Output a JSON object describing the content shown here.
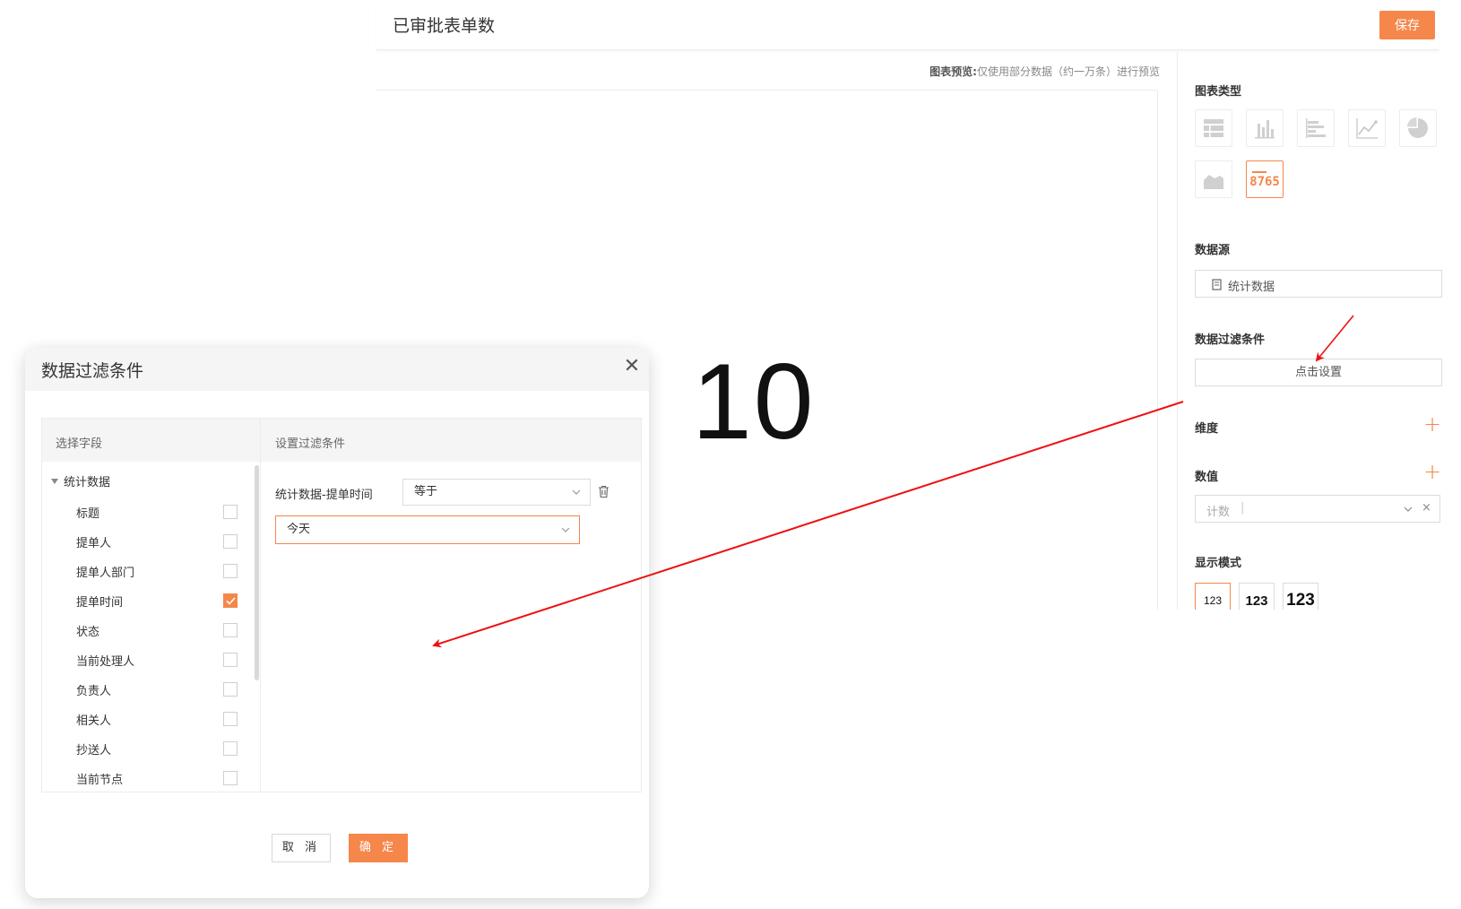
{
  "header": {
    "title": "已审批表单数",
    "save_label": "保存"
  },
  "preview": {
    "note_label": "图表预览:",
    "note_text": "仅使用部分数据（约一万条）进行预览",
    "value": "10"
  },
  "right_panel": {
    "chart_type_title": "图表类型",
    "chart_types": [
      "table-chart-icon",
      "bar-chart-icon",
      "horizontal-bar-chart-icon",
      "line-chart-icon",
      "pie-chart-icon",
      "area-chart-icon",
      "number-card-icon"
    ],
    "number_card_label": "8765",
    "data_source_title": "数据源",
    "data_source_value": "统计数据",
    "filter_title": "数据过滤条件",
    "filter_button": "点击设置",
    "dimension_title": "维度",
    "value_title": "数值",
    "value_field": "计数",
    "display_mode_title": "显示模式",
    "display_modes": [
      "123",
      "123",
      "123"
    ]
  },
  "modal": {
    "title": "数据过滤条件",
    "left_header": "选择字段",
    "right_header": "设置过滤条件",
    "tree_root": "统计数据",
    "fields": [
      {
        "label": "标题",
        "checked": false
      },
      {
        "label": "提单人",
        "checked": false
      },
      {
        "label": "提单人部门",
        "checked": false
      },
      {
        "label": "提单时间",
        "checked": true
      },
      {
        "label": "状态",
        "checked": false
      },
      {
        "label": "当前处理人",
        "checked": false
      },
      {
        "label": "负责人",
        "checked": false
      },
      {
        "label": "相关人",
        "checked": false
      },
      {
        "label": "抄送人",
        "checked": false
      },
      {
        "label": "当前节点",
        "checked": false
      }
    ],
    "condition": {
      "field": "统计数据-提单时间",
      "operator": "等于",
      "value": "今天"
    },
    "cancel_label": "取 消",
    "ok_label": "确 定"
  },
  "colors": {
    "accent": "#f5874b",
    "annotation_arrow": "#ee1111"
  }
}
